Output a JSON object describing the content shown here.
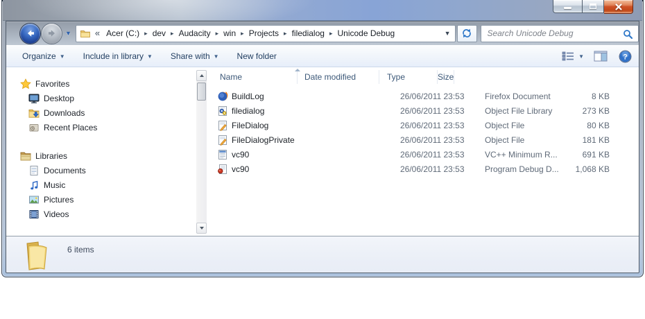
{
  "colors": {
    "close_button_red": "#cf5126",
    "back_button_blue": "#2c5fbe",
    "titlebar_glass_blue": "#8aa5d6",
    "toolbar_text_blue": "#1f3c5f",
    "folder_yellow": "#efc768",
    "placeholder_gray": "#7d828a"
  },
  "window": {
    "controls": [
      {
        "name": "minimize-button",
        "icon": "minimize-icon"
      },
      {
        "name": "maximize-button",
        "icon": "maximize-icon"
      },
      {
        "name": "close-button",
        "icon": "close-icon"
      }
    ]
  },
  "navigation": {
    "back_icon": "back-arrow-icon",
    "forward_icon": "forward-arrow-icon",
    "history_dropdown_icon": "chevron-down-icon",
    "breadcrumb": {
      "overflow_icon": "chevrons-left-icon",
      "folder_icon": "folder-icon",
      "separator_icon": "chevron-right-icon",
      "dropdown_icon": "chevron-down-icon",
      "items": [
        "Acer (C:)",
        "dev",
        "Audacity",
        "win",
        "Projects",
        "filedialog",
        "Unicode Debug"
      ]
    },
    "refresh_icon": "refresh-icon",
    "search": {
      "placeholder": "Search Unicode Debug",
      "icon": "search-icon",
      "value": ""
    }
  },
  "toolbar": {
    "items": [
      {
        "label": "Organize",
        "has_dropdown": true
      },
      {
        "label": "Include in library",
        "has_dropdown": true
      },
      {
        "label": "Share with",
        "has_dropdown": true
      },
      {
        "label": "New folder",
        "has_dropdown": false
      }
    ],
    "right_icons": [
      "views-icon",
      "preview-pane-icon",
      "help-icon"
    ]
  },
  "sidebar": {
    "sections": [
      {
        "label": "Favorites",
        "icon": "star-icon",
        "children": [
          {
            "label": "Desktop",
            "icon": "monitor-icon"
          },
          {
            "label": "Downloads",
            "icon": "downloads-folder-icon"
          },
          {
            "label": "Recent Places",
            "icon": "recent-places-icon"
          }
        ]
      },
      {
        "label": "Libraries",
        "icon": "libraries-icon",
        "children": [
          {
            "label": "Documents",
            "icon": "document-icon"
          },
          {
            "label": "Music",
            "icon": "music-note-icon"
          },
          {
            "label": "Pictures",
            "icon": "picture-icon"
          },
          {
            "label": "Videos",
            "icon": "video-icon"
          }
        ]
      }
    ]
  },
  "file_list": {
    "columns": [
      "Name",
      "Date modified",
      "Type",
      "Size"
    ],
    "sort": {
      "column": "Name",
      "direction": "ascending"
    },
    "rows": [
      {
        "name": "BuildLog",
        "icon": "firefox-document-icon",
        "date_modified": "26/06/2011 23:53",
        "type": "Firefox Document",
        "size": "8 KB"
      },
      {
        "name": "filedialog",
        "icon": "object-library-icon",
        "date_modified": "26/06/2011 23:53",
        "type": "Object File Library",
        "size": "273 KB"
      },
      {
        "name": "FileDialog",
        "icon": "object-file-icon",
        "date_modified": "26/06/2011 23:53",
        "type": "Object File",
        "size": "80 KB"
      },
      {
        "name": "FileDialogPrivate",
        "icon": "object-file-icon",
        "date_modified": "26/06/2011 23:53",
        "type": "Object File",
        "size": "181 KB"
      },
      {
        "name": "vc90",
        "icon": "manifest-icon",
        "date_modified": "26/06/2011 23:53",
        "type": "VC++ Minimum R...",
        "size": "691 KB"
      },
      {
        "name": "vc90",
        "icon": "pdb-icon",
        "date_modified": "26/06/2011 23:53",
        "type": "Program Debug D...",
        "size": "1,068 KB"
      }
    ]
  },
  "status_bar": {
    "items_count": "6 items",
    "icon": "large-folder-icon"
  }
}
